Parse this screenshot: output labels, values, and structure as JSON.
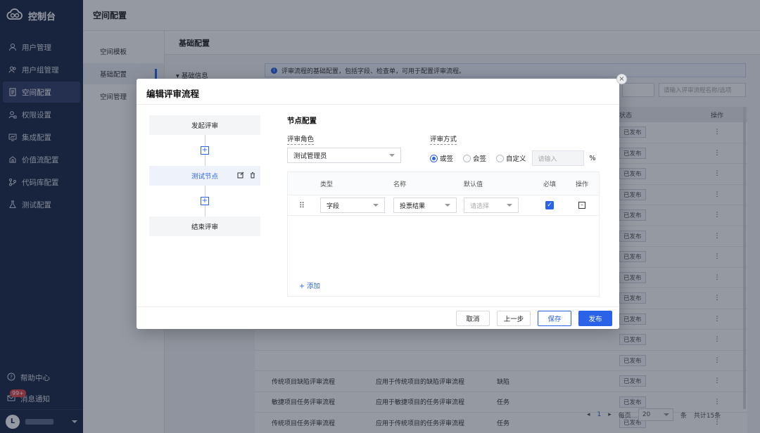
{
  "app": {
    "title": "控制台"
  },
  "sidebar": {
    "items": [
      {
        "label": "用户管理",
        "icon": "user-icon"
      },
      {
        "label": "用户组管理",
        "icon": "users-icon"
      },
      {
        "label": "空间配置",
        "icon": "document-icon",
        "active": true
      },
      {
        "label": "权限设置",
        "icon": "lock-user-icon"
      },
      {
        "label": "集成配置",
        "icon": "integration-icon"
      },
      {
        "label": "价值流配置",
        "icon": "flow-icon"
      },
      {
        "label": "代码库配置",
        "icon": "code-icon"
      },
      {
        "label": "测试配置",
        "icon": "flask-icon"
      }
    ],
    "help": "帮助中心",
    "notify": "消息通知",
    "notify_badge": "99+",
    "avatar_letter": "L"
  },
  "topbar": {
    "title": "空间配置"
  },
  "subnav": {
    "items": [
      "空间模板",
      "基础配置",
      "空间管理"
    ]
  },
  "content": {
    "header": "基础配置",
    "section": "基础信息",
    "info": "评审流程的基础配置，包括字段、检查单，可用于配置评审流程。",
    "search_placeholder": "请输入评审流程名称/选项",
    "table": {
      "headers": {
        "status": "状态",
        "op": "操作"
      },
      "rows": [
        {
          "name": "",
          "desc": "",
          "type": "",
          "status": "已发布"
        },
        {
          "name": "",
          "desc": "",
          "type": "",
          "status": "已发布"
        },
        {
          "name": "",
          "desc": "",
          "type": "",
          "status": "已发布"
        },
        {
          "name": "",
          "desc": "",
          "type": "",
          "status": "已发布"
        },
        {
          "name": "",
          "desc": "",
          "type": "",
          "status": "已发布"
        },
        {
          "name": "",
          "desc": "",
          "type": "",
          "status": "已发布"
        },
        {
          "name": "",
          "desc": "",
          "type": "",
          "status": "已发布"
        },
        {
          "name": "",
          "desc": "",
          "type": "",
          "status": "已发布"
        },
        {
          "name": "",
          "desc": "",
          "type": "",
          "status": "已发布"
        },
        {
          "name": "",
          "desc": "",
          "type": "",
          "status": "已发布"
        },
        {
          "name": "",
          "desc": "",
          "type": "",
          "status": "已发布"
        },
        {
          "name": "",
          "desc": "",
          "type": "",
          "status": "已发布"
        },
        {
          "name": "传统项目缺陷评审流程",
          "desc": "应用于传统项目的缺陷评审流程",
          "type": "缺陷",
          "status": "已发布"
        },
        {
          "name": "敏捷项目任务评审流程",
          "desc": "应用于敏捷项目的任务评审流程",
          "type": "任务",
          "status": "已发布"
        },
        {
          "name": "传统项目任务评审流程",
          "desc": "应用于传统项目的任务评审流程",
          "type": "任务",
          "status": "已发布"
        }
      ]
    },
    "pager": {
      "page": "1",
      "per_page_label": "每页",
      "per_page": "20",
      "unit": "条",
      "total": "共计15条"
    }
  },
  "modal": {
    "title": "编辑评审流程",
    "flow": {
      "start": "发起评审",
      "node": "测试节点",
      "end": "结束评审"
    },
    "config": {
      "title": "节点配置",
      "role_label": "评审角色",
      "role_value": "测试管理员",
      "method_label": "评审方式",
      "methods": [
        "或签",
        "会签",
        "自定义"
      ],
      "selected_method": "或签",
      "custom_placeholder": "请输入",
      "percent": "%",
      "grid": {
        "headers": [
          "类型",
          "名称",
          "默认值",
          "必填",
          "操作"
        ],
        "row": {
          "type": "字段",
          "name": "投票结果",
          "default_placeholder": "请选择",
          "required": true
        }
      },
      "add": "+ 添加"
    },
    "buttons": {
      "cancel": "取消",
      "prev": "上一步",
      "save": "保存",
      "publish": "发布"
    }
  },
  "colors": {
    "sidebar": "#1d2a49",
    "accent": "#2a63e8"
  }
}
